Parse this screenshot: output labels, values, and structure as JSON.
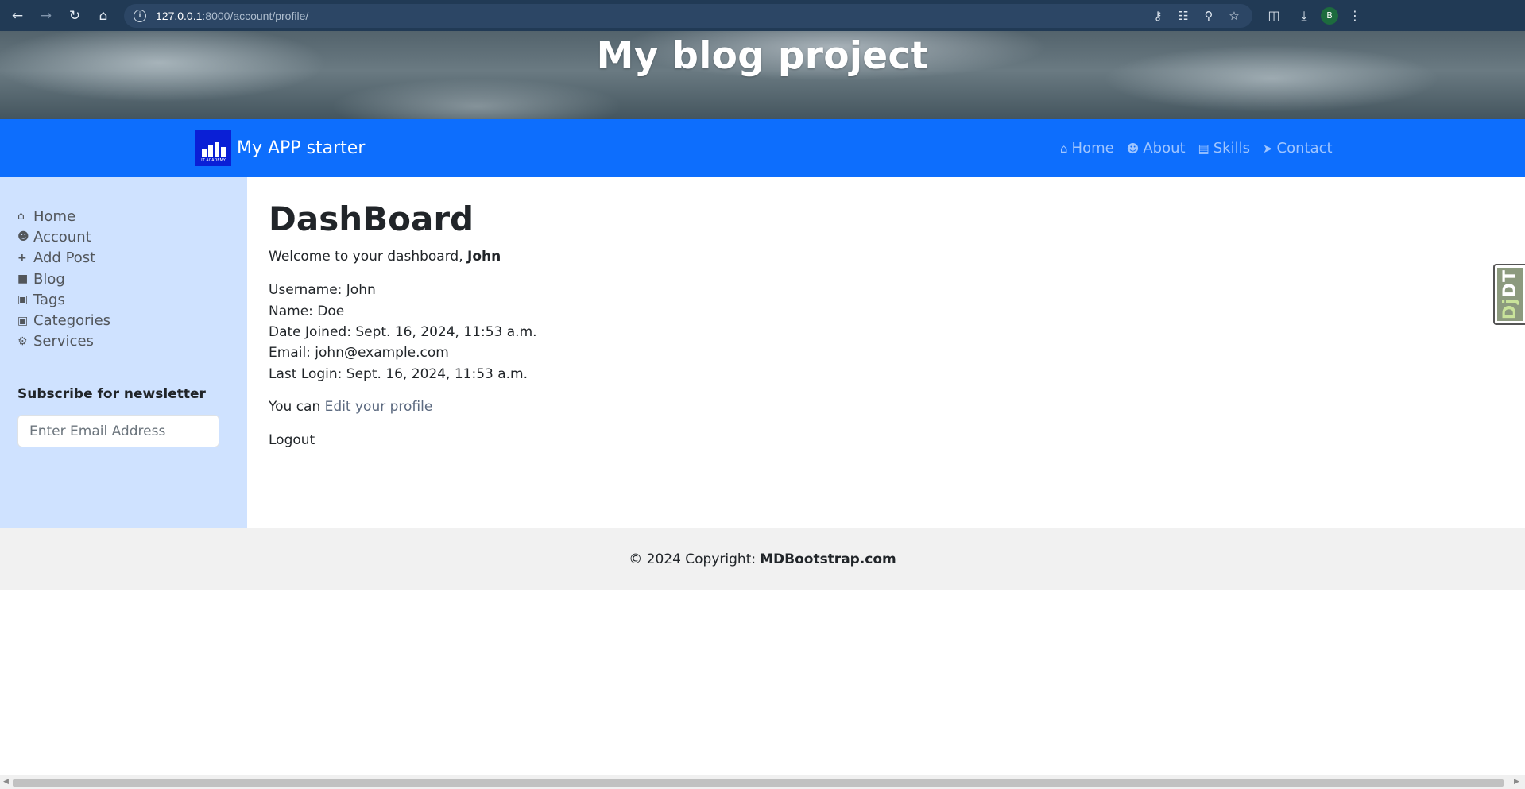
{
  "browser": {
    "url_host": "127.0.0.1",
    "url_path": ":8000/account/profile/",
    "profile_initial": "B"
  },
  "hero": {
    "title": "My blog project"
  },
  "navbar": {
    "brand_name": "My APP starter",
    "links": [
      {
        "label": "Home",
        "icon": "home-icon"
      },
      {
        "label": "About",
        "icon": "user-icon"
      },
      {
        "label": "Skills",
        "icon": "book-icon"
      },
      {
        "label": "Contact",
        "icon": "paper-plane-icon"
      }
    ]
  },
  "sidebar": {
    "items": [
      {
        "label": "Home",
        "icon": "home-icon"
      },
      {
        "label": "Account",
        "icon": "user-icon"
      },
      {
        "label": "Add Post",
        "icon": "plus-icon"
      },
      {
        "label": "Blog",
        "icon": "sticky-note-icon"
      },
      {
        "label": "Tags",
        "icon": "briefcase-icon"
      },
      {
        "label": "Categories",
        "icon": "briefcase-icon"
      },
      {
        "label": "Services",
        "icon": "gears-icon"
      }
    ],
    "newsletter_title": "Subscribe for newsletter",
    "newsletter_placeholder": "Enter Email Address"
  },
  "main": {
    "title": "DashBoard",
    "welcome_prefix": "Welcome to your dashboard,",
    "welcome_name": "John",
    "info": [
      "Username: John",
      "Name: Doe",
      "Date Joined: Sept. 16, 2024, 11:53 a.m.",
      "Email: john@example.com",
      "Last Login: Sept. 16, 2024, 11:53 a.m."
    ],
    "edit_prefix": "You can",
    "edit_link": "Edit your profile",
    "logout": "Logout"
  },
  "djdt": {
    "label_dj": "Dj",
    "label_dt": "DT"
  },
  "footer": {
    "copyright": "© 2024 Copyright:",
    "brand": "MDBootstrap.com"
  },
  "colors": {
    "navbar": "#0d6efd",
    "sidebar": "#cfe2ff",
    "footer": "#f1f1f1",
    "browser_bar": "#213a55"
  }
}
